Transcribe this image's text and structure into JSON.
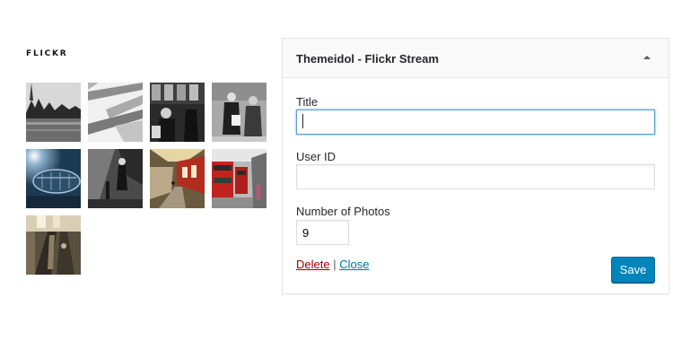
{
  "sidebar_widget": {
    "heading": "FLICKR",
    "photos": [
      {
        "icon": "photo-lake-trees"
      },
      {
        "icon": "photo-architecture"
      },
      {
        "icon": "photo-street-building"
      },
      {
        "icon": "photo-elderly-couple"
      },
      {
        "icon": "photo-ferris-wheel-capsule"
      },
      {
        "icon": "photo-figure-bw"
      },
      {
        "icon": "photo-subway-train"
      },
      {
        "icon": "photo-red-buses"
      },
      {
        "icon": "photo-escalator"
      }
    ]
  },
  "widget_form": {
    "title": "Themeidol - Flickr Stream",
    "toggle_icon": "triangle-up-icon",
    "fields": {
      "title_label": "Title",
      "title_value": "",
      "user_id_label": "User ID",
      "user_id_value": "",
      "photos_label": "Number of Photos",
      "photos_value": "9"
    },
    "actions": {
      "delete_label": "Delete",
      "separator": "|",
      "close_label": "Close",
      "save_label": "Save"
    },
    "colors": {
      "primary_button": "#0085ba",
      "delete_link": "#a00000",
      "close_link": "#0073aa",
      "focus_border": "#5b9dd9"
    }
  }
}
